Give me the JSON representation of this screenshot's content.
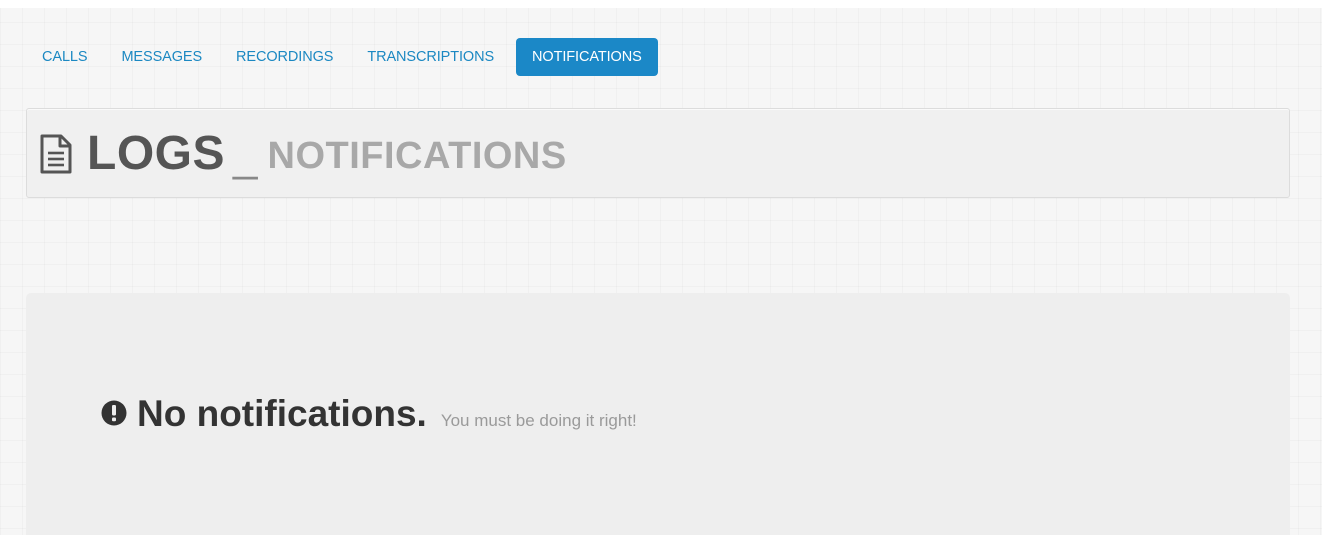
{
  "nav": {
    "tabs": [
      {
        "label": "CALLS",
        "active": false
      },
      {
        "label": "MESSAGES",
        "active": false
      },
      {
        "label": "RECORDINGS",
        "active": false
      },
      {
        "label": "TRANSCRIPTIONS",
        "active": false
      },
      {
        "label": "NOTIFICATIONS",
        "active": true
      }
    ]
  },
  "header": {
    "icon": "document-icon",
    "title": "LOGS",
    "separator": "_",
    "subtitle": "NOTIFICATIONS"
  },
  "empty_state": {
    "icon": "exclamation-circle-icon",
    "heading": "No notifications.",
    "message": "You must be doing it right!"
  },
  "colors": {
    "accent": "#1b88c7",
    "title": "#555555",
    "subtitle": "#a8a8a8",
    "panel_bg": "#eeeeee"
  }
}
